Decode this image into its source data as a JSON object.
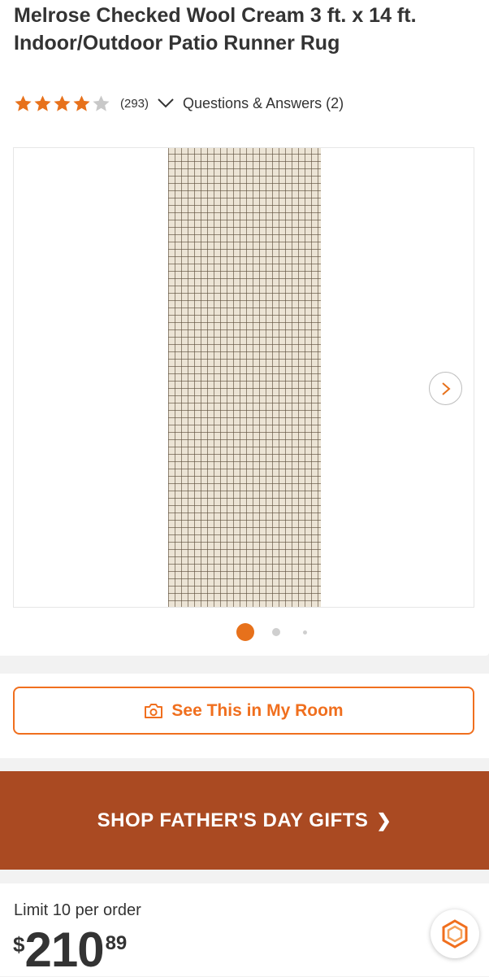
{
  "product": {
    "title": "Melrose Checked Wool Cream 3 ft. x 14 ft. Indoor/Outdoor Patio Runner Rug",
    "rating": 4,
    "rating_max": 5,
    "review_count": "(293)",
    "qa_label": "Questions & Answers (2)"
  },
  "gallery": {
    "slides_total": 3,
    "active_index": 0,
    "next_icon": "chevron-right-icon"
  },
  "actions": {
    "see_in_room_label": "See This in My Room",
    "see_in_room_icon": "camera-icon"
  },
  "promo": {
    "banner_text": "SHOP FATHER'S DAY GIFTS",
    "arrow": "❯"
  },
  "pricing": {
    "limit_text": "Limit 10 per order",
    "currency": "$",
    "dollars": "210",
    "cents": "89"
  },
  "colors": {
    "accent": "#f06f1e",
    "banner": "#aa4a22",
    "star_filled": "#e7711b",
    "star_empty": "#c8c8c8"
  }
}
